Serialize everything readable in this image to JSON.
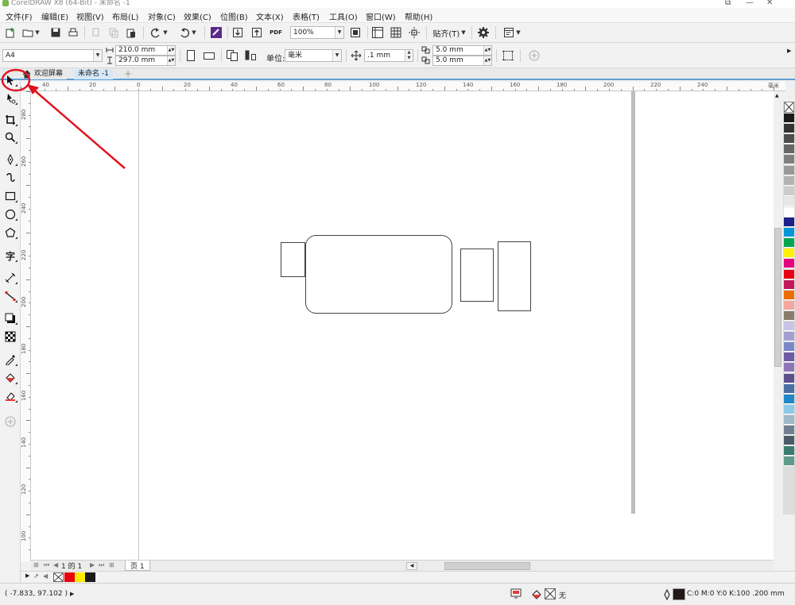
{
  "window": {
    "title": "CorelDRAW X8 (64-Bit) - 未命名 -1"
  },
  "menu": [
    "文件(F)",
    "编辑(E)",
    "视图(V)",
    "布局(L)",
    "对象(C)",
    "效果(C)",
    "位图(B)",
    "文本(X)",
    "表格(T)",
    "工具(O)",
    "窗口(W)",
    "帮助(H)"
  ],
  "std_toolbar": {
    "zoom": "100%",
    "snap_label": "贴齐(T)",
    "pdf_label": "PDF"
  },
  "property_bar": {
    "page_size": "A4",
    "width": "210.0 mm",
    "height": "297.0 mm",
    "units_label": "单位:",
    "units_value": "毫米",
    "nudge": ".1 mm",
    "dup_x": "5.0 mm",
    "dup_y": "5.0 mm"
  },
  "tabs": [
    {
      "label": "欢迎屏幕"
    },
    {
      "label": "未命名 -1"
    }
  ],
  "ruler": {
    "h_labels": [
      "40",
      "20",
      "0",
      "20",
      "40",
      "60",
      "80",
      "100",
      "120",
      "140",
      "160",
      "180",
      "200",
      "220",
      "240"
    ],
    "h_unit": "毫米",
    "v_labels": [
      "280",
      "260",
      "240",
      "220",
      "200",
      "180",
      "160",
      "140",
      "120",
      "100"
    ]
  },
  "page_nav": {
    "counter": "1 的 1",
    "page_tab": "页 1"
  },
  "doc_palette": {
    "swatches": [
      "#e8000b",
      "#ffea00",
      "#1a1a1a"
    ]
  },
  "palette": {
    "swatches": [
      "#1a1a1a",
      "#333333",
      "#4d4d4d",
      "#666666",
      "#7f7f7f",
      "#999999",
      "#b3b3b3",
      "#cccccc",
      "#e6e6e6",
      "#ffffff",
      "#1d2088",
      "#0096d6",
      "#00a650",
      "#fff200",
      "#e4007f",
      "#e60012",
      "#c2185b",
      "#ed6d00",
      "#f4a7a0",
      "#8b7d6b",
      "#c9c3e6",
      "#a3a0cf",
      "#7a88c8",
      "#6d5ba3",
      "#8e75b6",
      "#5b4f8c",
      "#4a6fa5",
      "#1e88c8",
      "#8ecae6",
      "#a0b8c8",
      "#708090",
      "#4a5a66",
      "#3a7d6e",
      "#5f9a8a"
    ]
  },
  "status": {
    "coords": "( -7.833, 97.102 )",
    "fill_label": "无",
    "outline_info": "C:0 M:0 Y:0 K:100 .200 mm"
  },
  "colors": {
    "accent": "#5ea0d6",
    "annotation_red": "#e0141e"
  }
}
